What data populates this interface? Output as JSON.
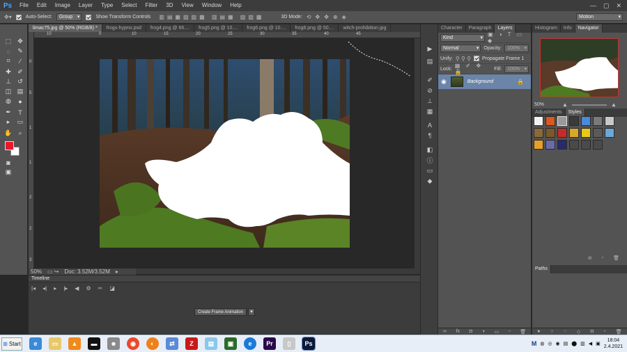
{
  "app": {
    "logo": "Ps"
  },
  "menu": [
    "File",
    "Edit",
    "Image",
    "Layer",
    "Type",
    "Select",
    "Filter",
    "3D",
    "View",
    "Window",
    "Help"
  ],
  "window_controls": [
    "—",
    "▢",
    "✕"
  ],
  "options": {
    "auto_select_label": "Auto-Select:",
    "auto_select_value": "Group",
    "transform_label": "Show Transform Controls",
    "mode_3d_label": "3D Mode:",
    "workspace": "Motion"
  },
  "doc_tabs": [
    {
      "label": "limac75.jpg @ 50% (RGB/8) *",
      "active": true
    },
    {
      "label": "frogs-hypno.psd",
      "active": false
    },
    {
      "label": "frog4.png @ 66....",
      "active": false
    },
    {
      "label": "frog5.png @ 10....",
      "active": false
    },
    {
      "label": "frog6.png @ 10....",
      "active": false
    },
    {
      "label": "frog8.png @ 50....",
      "active": false
    },
    {
      "label": "witch-prohibition.jpg",
      "active": false
    }
  ],
  "ruler": {
    "h": [
      "10",
      "0",
      "10",
      "15",
      "20",
      "25",
      "30",
      "35",
      "40",
      "45"
    ],
    "v": [
      "0",
      "5",
      "1",
      "1",
      "2",
      "2",
      "3"
    ]
  },
  "status": {
    "zoom": "50%",
    "doc": "Doc: 3.52M/3.52M"
  },
  "timeline": {
    "title": "Timeline",
    "create_button": "Create Frame Animation"
  },
  "layers_panel": {
    "tabs": [
      "Character",
      "Paragraph",
      "Layers"
    ],
    "kind": "Kind",
    "blend_mode": "Normal",
    "opacity_label": "Opacity:",
    "opacity_value": "100%",
    "unify_label": "Unify:",
    "propagate_label": "Propagate Frame 1",
    "lock_label": "Lock:",
    "fill_label": "Fill:",
    "fill_value": "100%",
    "layer_name": "Background"
  },
  "navigator_panel": {
    "tabs": [
      "Histogram",
      "Info",
      "Navigator"
    ],
    "zoom": "50%"
  },
  "styles_panel": {
    "tabs": [
      "Adjustments",
      "Styles"
    ]
  },
  "paths_panel": {
    "title": "Paths"
  },
  "taskbar": {
    "start_label": "Start",
    "tray_lang": "M",
    "time": "18:04",
    "date": "2.4.2021"
  }
}
